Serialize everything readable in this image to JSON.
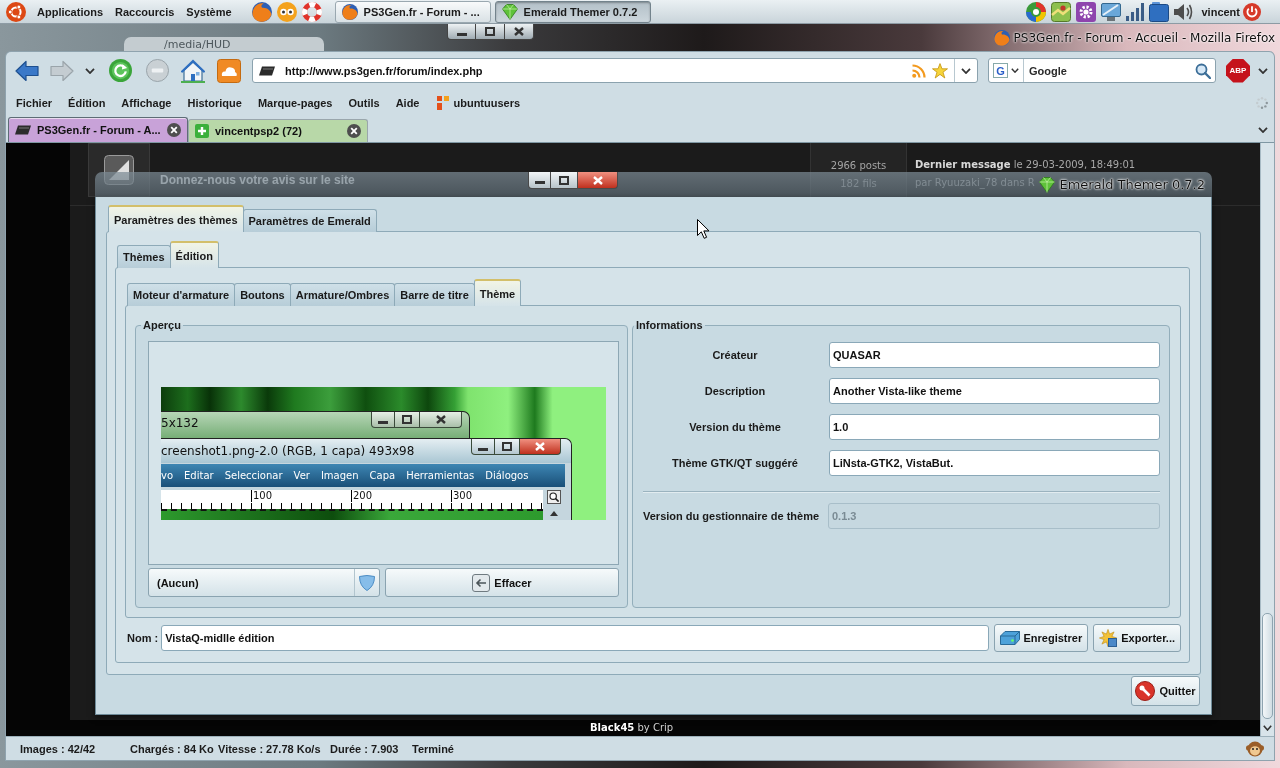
{
  "top_panel": {
    "menus": [
      "Applications",
      "Raccourcis",
      "Système"
    ],
    "tasks": [
      {
        "label": "PS3Gen.fr - Forum - ...",
        "kind": "browser",
        "selected": false
      },
      {
        "label": "Emerald Themer 0.7.2",
        "kind": "themer",
        "selected": true
      }
    ],
    "user": "vincent"
  },
  "background_window": {
    "title": "/media/HUD"
  },
  "browser": {
    "title": "PS3Gen.fr - Forum - Accueil - Mozilla Firefox",
    "url": "http://www.ps3gen.fr/forum/index.php",
    "search": {
      "engine": "G",
      "placeholder": "Google"
    },
    "adblock": "ABP",
    "menu": [
      "Fichier",
      "Édition",
      "Affichage",
      "Historique",
      "Marque-pages",
      "Outils",
      "Aide"
    ],
    "bookmarks": [
      "ubuntuusers"
    ],
    "tabs": [
      {
        "label": "PS3Gen.fr - Forum - A...",
        "kind": "forum",
        "selected": true,
        "color": "#c8a2d8"
      },
      {
        "label": "vincentpsp2 (72)",
        "kind": "profile",
        "selected": false,
        "color": "#b8d8a8"
      }
    ],
    "status": [
      "Images : 42/42",
      "Chargés : 84 Ko",
      "Vitesse : 27.78 Ko/s",
      "Durée : 7.903",
      "Terminé"
    ]
  },
  "page": {
    "forum_title": "Donnez-nous votre avis sur le site",
    "stats": [
      "2966 posts",
      "182 fils"
    ],
    "last_post": [
      "**Dernier message** le 29-03-2009, 18:49:01",
      "par Ryuuzaki_78 dans R"
    ],
    "footer": "**Black45** by Crip"
  },
  "dialog": {
    "title": "Emerald Themer 0.7.2",
    "tabs": [
      {
        "label": "Paramètres des thèmes",
        "selected": true
      },
      {
        "label": "Paramètres de Emerald",
        "selected": false
      }
    ],
    "subtabs": [
      {
        "label": "Thèmes",
        "selected": false
      },
      {
        "label": "Édition",
        "selected": true
      }
    ],
    "editor_tabs": [
      {
        "label": "Moteur d'armature",
        "selected": false
      },
      {
        "label": "Boutons",
        "selected": false
      },
      {
        "label": "Armature/Ombres",
        "selected": false
      },
      {
        "label": "Barre de titre",
        "selected": false
      },
      {
        "label": "Thème",
        "selected": true
      }
    ],
    "preview": {
      "title": "Aperçu",
      "image": {
        "back_window": "5x132",
        "front_window": "creenshot1.png-2.0 (RGB, 1 capa) 493x98",
        "menu": [
          "vo",
          "Editar",
          "Seleccionar",
          "Ver",
          "Imagen",
          "Capa",
          "Herramientas",
          "Diálogos"
        ],
        "ruler": [
          "100",
          "200",
          "300"
        ]
      },
      "picker": "(Aucun)",
      "clear": "Effacer"
    },
    "info": {
      "title": "Informations",
      "fields": [
        {
          "label": "Créateur",
          "value": "QUASAR"
        },
        {
          "label": "Description",
          "value": "Another Vista-like theme"
        },
        {
          "label": "Version du thème",
          "value": "1.0"
        },
        {
          "label": "Thème GTK/QT suggéré",
          "value": "LiNsta-GTK2, VistaBut."
        }
      ],
      "manager": {
        "label": "Version du gestionnaire de thème",
        "value": "0.1.3",
        "disabled": true
      }
    },
    "name": {
      "label": "Nom :",
      "value": "VistaQ-midlle édition"
    },
    "actions": [
      {
        "label": "Enregistrer",
        "kind": "save"
      },
      {
        "label": "Exporter...",
        "kind": "export"
      }
    ],
    "quit": "Quitter"
  }
}
